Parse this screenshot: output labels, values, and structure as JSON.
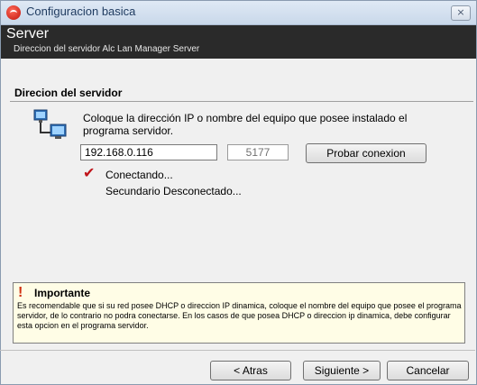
{
  "window": {
    "title": "Configuracion basica",
    "close_label": "×"
  },
  "header": {
    "title": "Server",
    "subtitle": "Direccion del servidor Alc Lan Manager Server"
  },
  "section": {
    "title": "Direcion del servidor"
  },
  "instruction": "Coloque la dirección IP o nombre del equipo que posee instalado el programa servidor.",
  "form": {
    "ip_value": "192.168.0.116",
    "port_value": "5177",
    "test_button": "Probar conexion"
  },
  "status": {
    "check_glyph": "✔",
    "line1": "Conectando...",
    "line2": "Secundario Desconectado..."
  },
  "notice": {
    "icon_glyph": "!",
    "title": "Importante",
    "text": "Es recomendable que si su red posee DHCP o direccion IP dinamica, coloque el nombre del equipo que posee el programa servidor, de lo contrario no podra conectarse. En los casos de que posea DHCP o direccion ip dinamica, debe configurar esta opcion en el programa servidor."
  },
  "footer": {
    "back": "< Atras",
    "next": "Siguiente >",
    "cancel": "Cancelar"
  },
  "icons": {
    "app": "app-logo-icon",
    "network": "network-computers-icon",
    "check": "check-icon",
    "warning": "warning-icon"
  },
  "colors": {
    "header_bg": "#2a2a2a",
    "check": "#c0141a",
    "notice_bg": "#fffde6"
  }
}
